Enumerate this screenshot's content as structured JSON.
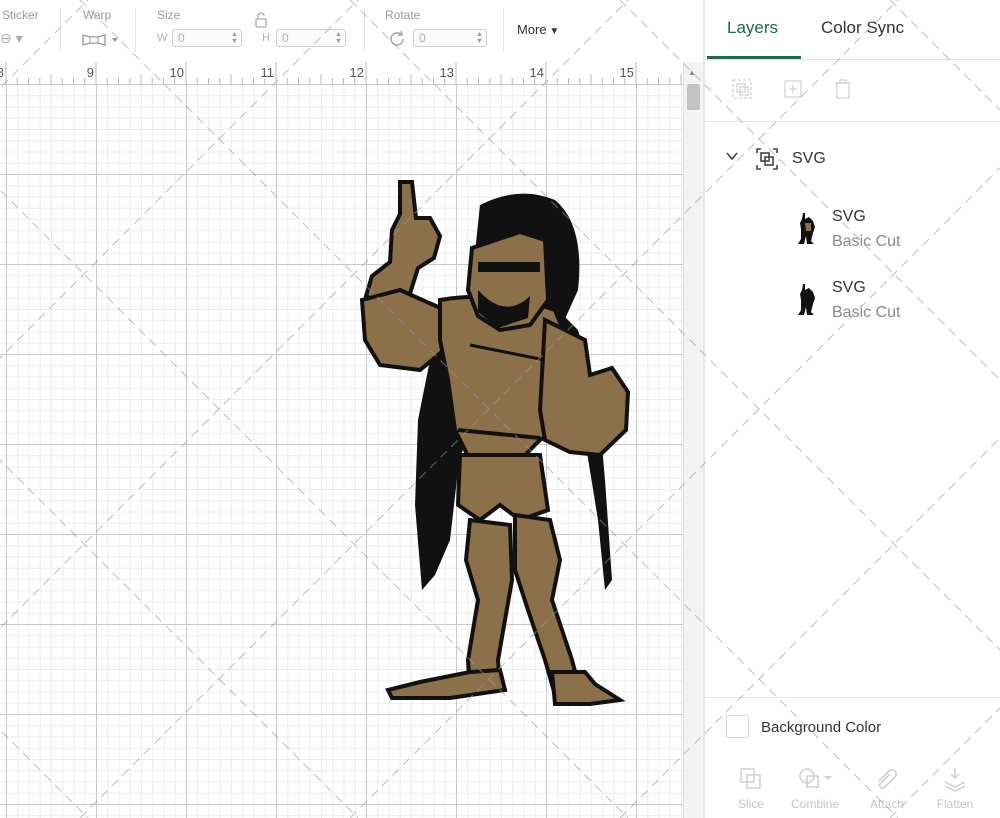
{
  "toolbar": {
    "sticker_label": "Sticker",
    "warp_label": "Warp",
    "size_label": "Size",
    "width_label": "W",
    "width_value": "0",
    "height_label": "H",
    "height_value": "0",
    "rotate_label": "Rotate",
    "rotate_value": "0",
    "more_label": "More"
  },
  "ruler": {
    "ticks": [
      "8",
      "9",
      "10",
      "11",
      "12",
      "13",
      "14",
      "15"
    ]
  },
  "panel": {
    "tabs": [
      {
        "label": "Layers",
        "active": true
      },
      {
        "label": "Color Sync",
        "active": false
      }
    ],
    "group": {
      "name": "SVG"
    },
    "layers": [
      {
        "name": "SVG",
        "type": "Basic Cut"
      },
      {
        "name": "SVG",
        "type": "Basic Cut"
      }
    ],
    "background_color_label": "Background Color",
    "actions": [
      "Slice",
      "Combine",
      "Attach",
      "Flatten"
    ]
  },
  "colors": {
    "accent": "#1b6b4a",
    "armor_gold": "#8b7049",
    "outline_black": "#111111"
  }
}
